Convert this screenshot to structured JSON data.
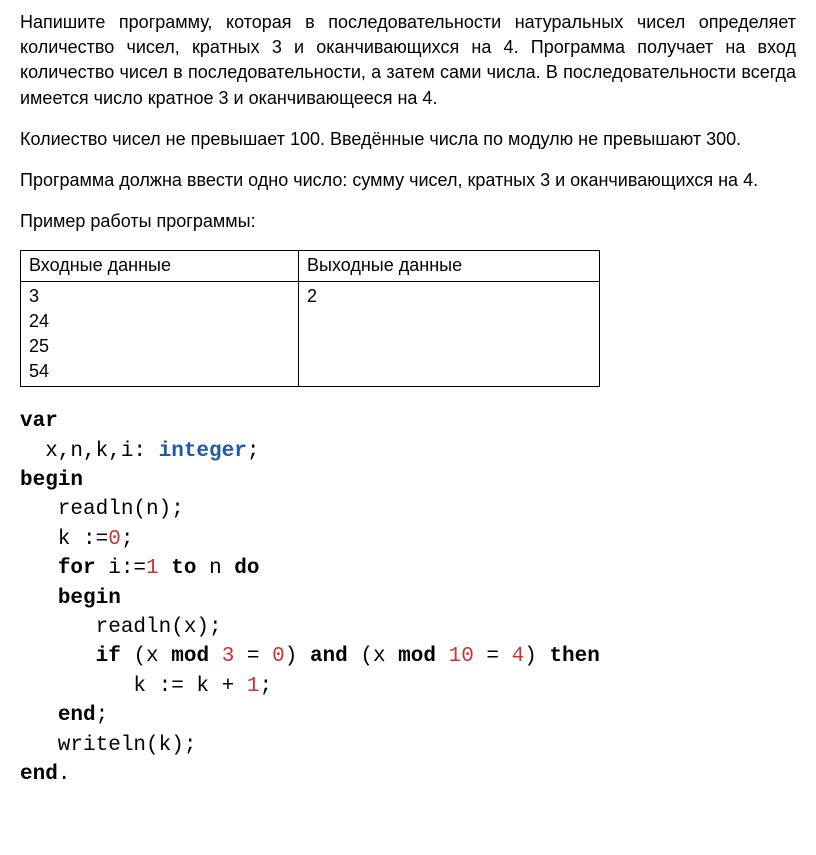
{
  "para1": "Напишите программу, которая в последовательности натуральных чисел определяет количество чисел, кратных 3 и оканчивающихся на 4. Программа получает на вход количество чисел в последовательности, а затем сами числа. В последовательности всегда имеется число кратное 3 и оканчивающееся на 4.",
  "para2": "Колиество чисел не превышает 100. Введённые числа по модулю не превышают 300.",
  "para3": "Программа должна ввести одно число: сумму чисел, кратных 3 и оканчивающихся на 4.",
  "para4": "Пример работы программы:",
  "table": {
    "header_in": "Входные данные",
    "header_out": "Выходные данные",
    "input": "3\n24\n25\n54",
    "output": "2"
  },
  "code": {
    "kw_var": "var",
    "decl_pre": "  x,n,k,i: ",
    "type_integer": "integer",
    "decl_post": ";",
    "kw_begin": "begin",
    "l_readln_n": "   readln(n);",
    "l_k_pre": "   k :=",
    "zero": "0",
    "l_k_post": ";",
    "for_pre": "   ",
    "kw_for": "for",
    "for_i": " i:=",
    "one": "1",
    "sp": " ",
    "kw_to": "to",
    "for_n": " n ",
    "kw_do": "do",
    "inner_begin_pre": "   ",
    "l_readln_x": "      readln(x);",
    "if_pre": "      ",
    "kw_if": "if",
    "if_open": " (x ",
    "kw_mod": "mod",
    "three": "3",
    "eq0": " = ",
    "close_paren": ") ",
    "kw_and": "and",
    "if_open2": " (x ",
    "ten": "10",
    "four": "4",
    "kw_then": "then",
    "l_k_inc_pre": "         k := k + ",
    "l_k_inc_post": ";",
    "kw_end": "end",
    "end_semi": ";",
    "l_writeln": "   writeln(k);",
    "end_dot": "."
  }
}
